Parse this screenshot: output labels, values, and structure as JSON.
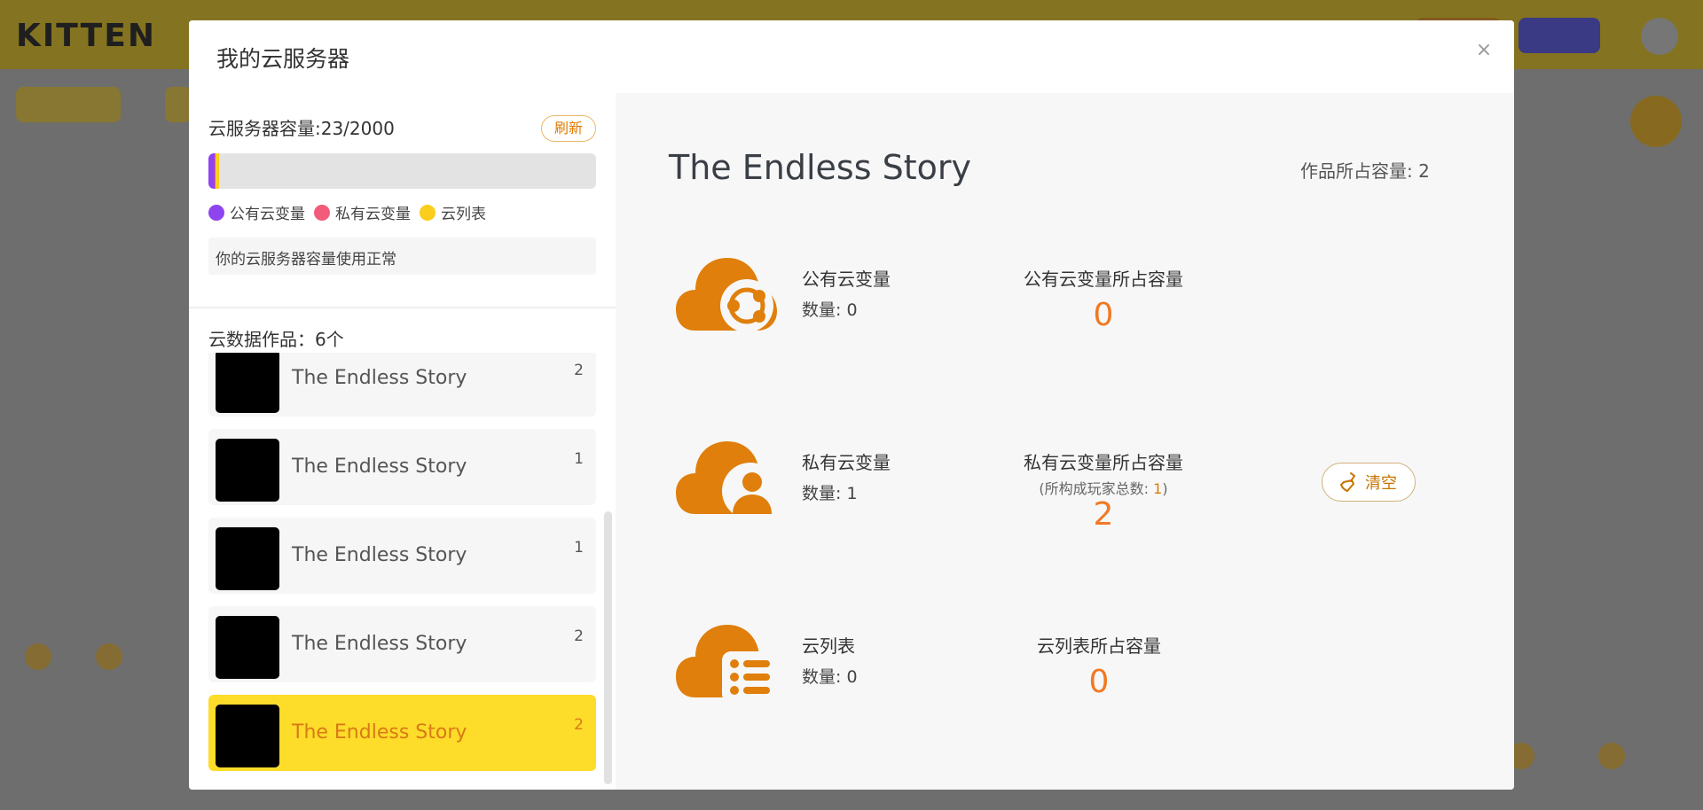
{
  "background": {
    "logo": "KITTEN"
  },
  "modal": {
    "title": "我的云服务器",
    "close_icon": "×"
  },
  "sidebar": {
    "capacity_label": "云服务器容量:23/2000",
    "capacity_used_fraction": 0.0115,
    "capacity_segments": [
      {
        "name": "purple",
        "color": "#8e44ef",
        "fraction": 0.55
      },
      {
        "name": "pink",
        "color": "#f25c7a",
        "fraction": 0.15
      },
      {
        "name": "yellow",
        "color": "#fbcd1c",
        "fraction": 0.3
      }
    ],
    "refresh_label": "刷新",
    "legend": [
      {
        "label": "公有云变量",
        "color": "#8e44ef"
      },
      {
        "label": "私有云变量",
        "color": "#f25c7a"
      },
      {
        "label": "云列表",
        "color": "#fbcd1c"
      }
    ],
    "status_message": "你的云服务器容量使用正常",
    "works_count_label": "云数据作品：6个",
    "works": [
      {
        "title": "The Endless Story",
        "size": "2"
      },
      {
        "title": "The Endless Story",
        "size": "1"
      },
      {
        "title": "The Endless Story",
        "size": "1"
      },
      {
        "title": "The Endless Story",
        "size": "2"
      },
      {
        "title": "The Endless Story",
        "size": "2",
        "selected": true
      }
    ]
  },
  "main": {
    "title": "The Endless Story",
    "usage_label": "作品所占容量: 2",
    "rows": [
      {
        "icon": "public-cloud-variable-icon",
        "name": "公有云变量",
        "count": "数量: 0",
        "cap_label": "公有云变量所占容量",
        "cap_value": "0"
      },
      {
        "icon": "private-cloud-variable-icon",
        "name": "私有云变量",
        "count": "数量: 1",
        "cap_label": "私有云变量所占容量",
        "cap_sub_prefix": "(所构成玩家总数: ",
        "cap_sub_value": "1",
        "cap_sub_suffix": ")",
        "cap_value": "2",
        "clear_label": "清空"
      },
      {
        "icon": "cloud-list-icon",
        "name": "云列表",
        "count": "数量: 0",
        "cap_label": "云列表所占容量",
        "cap_value": "0"
      }
    ]
  },
  "colors": {
    "accent_orange": "#e07b00",
    "icon_orange": "#e07f0c",
    "selected_bg": "#fddc2a"
  }
}
